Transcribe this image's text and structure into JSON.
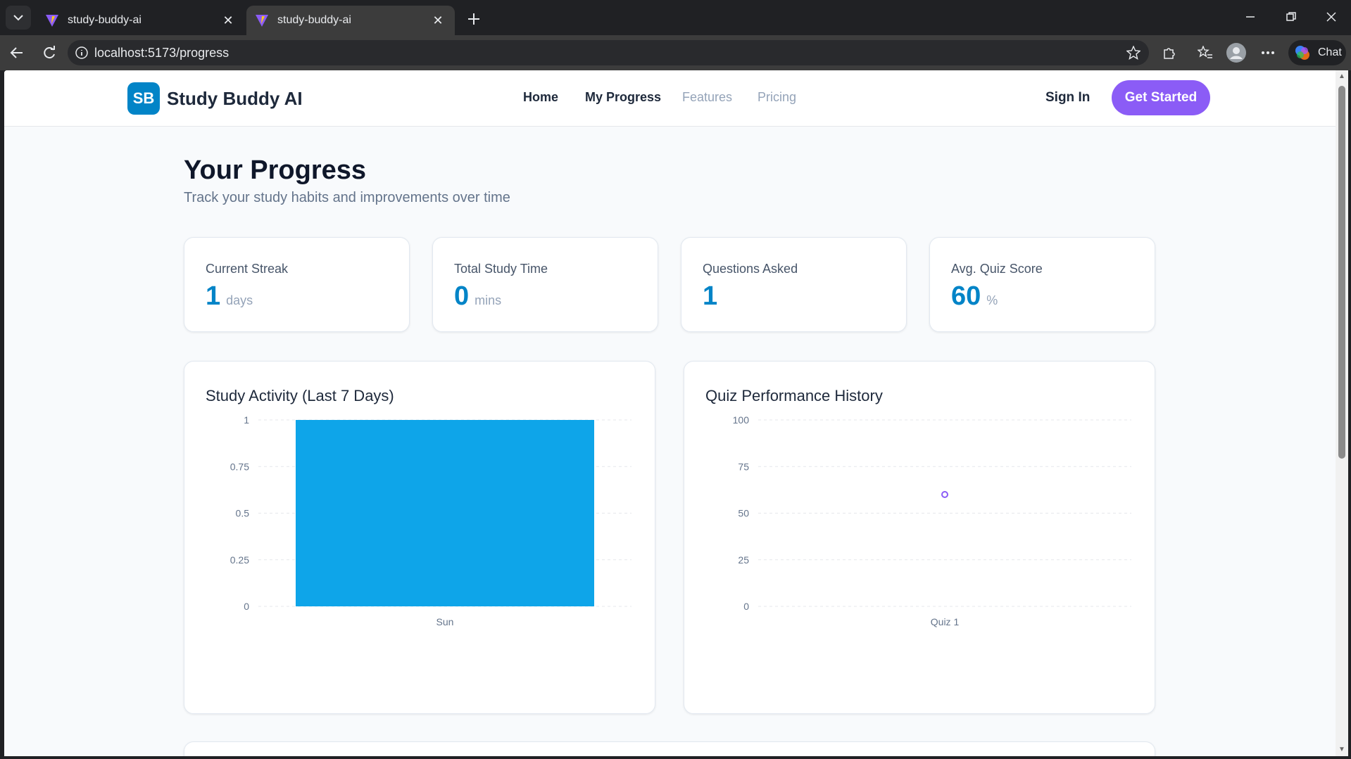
{
  "browser": {
    "tabs": [
      {
        "title": "study-buddy-ai",
        "active": false
      },
      {
        "title": "study-buddy-ai",
        "active": true
      }
    ],
    "url": "localhost:5173/progress",
    "chat_label": "Chat"
  },
  "site": {
    "logo_badge": "SB",
    "logo_text": "Study Buddy AI",
    "nav": [
      "Home",
      "My Progress",
      "Features",
      "Pricing"
    ],
    "sign_in": "Sign In",
    "cta": "Get Started",
    "brand_color": "#0284c7",
    "accent_color": "#8b5cf6"
  },
  "page": {
    "title": "Your Progress",
    "subtitle": "Track your study habits and improvements over time"
  },
  "stats": [
    {
      "label": "Current Streak",
      "value": "1",
      "unit": "days"
    },
    {
      "label": "Total Study Time",
      "value": "0",
      "unit": "mins"
    },
    {
      "label": "Questions Asked",
      "value": "1",
      "unit": ""
    },
    {
      "label": "Avg. Quiz Score",
      "value": "60",
      "unit": "%"
    }
  ],
  "charts": {
    "activity_title": "Study Activity (Last 7 Days)",
    "quiz_title": "Quiz Performance History"
  },
  "chart_data": [
    {
      "type": "bar",
      "title": "Study Activity (Last 7 Days)",
      "categories": [
        "Sun"
      ],
      "values": [
        1
      ],
      "ylim": [
        0,
        1
      ],
      "yticks": [
        "0",
        "0.25",
        "0.5",
        "0.75",
        "1"
      ],
      "color": "#0ea5e9",
      "grid": true
    },
    {
      "type": "line",
      "title": "Quiz Performance History",
      "categories": [
        "Quiz 1"
      ],
      "values": [
        60
      ],
      "ylim": [
        0,
        100
      ],
      "yticks": [
        "0",
        "25",
        "50",
        "75",
        "100"
      ],
      "color": "#8b5cf6",
      "grid": true
    }
  ]
}
